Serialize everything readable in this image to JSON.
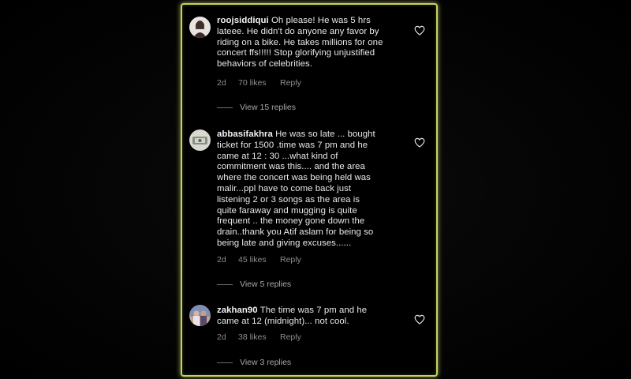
{
  "comments": [
    {
      "username": "roojsiddiqui",
      "lines": [
        "Oh please! He was 5 hrs",
        "lateee. He didn't do anyone any favor by",
        "riding on a bike. He takes millions for one",
        "concert ffs!!!!! Stop glorifying unjustified",
        "behaviors of celebrities."
      ],
      "age": "2d",
      "likes": "70 likes",
      "reply_label": "Reply",
      "view_replies": "View 15 replies",
      "avatar_icon": "profile-photo-icon"
    },
    {
      "username": "abbasifakhra",
      "lines": [
        "He was so late ... bought",
        "ticket for 1500 .time was 7 pm and he",
        "came at 12 : 30 ...what kind of",
        "commitment was this.... and the area",
        "where the concert was being  held was",
        "malir...ppl  have to come back just",
        "listening 2 or 3 songs  as the area is",
        "quite faraway and  mugging is quite",
        "frequent .. the money gone down the",
        "drain..thank you Atif aslam for being so",
        "being late and giving excuses......"
      ],
      "age": "2d",
      "likes": "45 likes",
      "reply_label": "Reply",
      "view_replies": "View 5 replies",
      "avatar_icon": "profile-photo-icon"
    },
    {
      "username": "zakhan90",
      "lines": [
        "The time was 7 pm and he",
        "came at 12 (midnight)... not cool."
      ],
      "age": "2d",
      "likes": "38 likes",
      "reply_label": "Reply",
      "view_replies": "View 3 replies",
      "avatar_icon": "profile-photo-icon"
    }
  ],
  "colors": {
    "panel_border": "#c9d25a",
    "text": "#e8e8e8",
    "meta": "#8e8e8e"
  }
}
